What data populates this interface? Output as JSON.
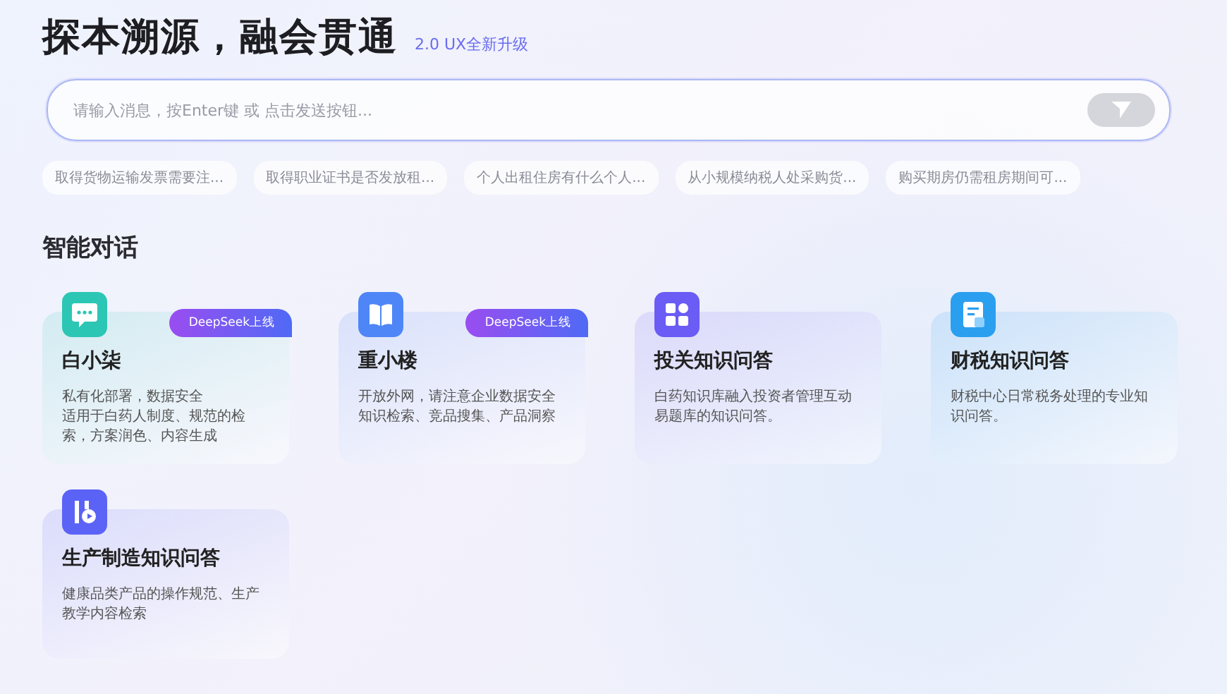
{
  "header": {
    "title": "探本溯源，融会贯通",
    "version_tag": "2.0 UX全新升级"
  },
  "chat_input": {
    "placeholder": "请输入消息，按Enter键 或 点击发送按钮..."
  },
  "suggestions": [
    "取得货物运输发票需要注...",
    "取得职业证书是否发放租...",
    "个人出租住房有什么个人...",
    "从小规模纳税人处采购货...",
    "购买期房仍需租房期间可..."
  ],
  "section_title": "智能对话",
  "assistants": [
    {
      "kind": "chat",
      "color": "#2cc6b4",
      "title": "白小柒",
      "badge": "DeepSeek上线",
      "description": [
        "私有化部署，数据安全",
        "适用于白药人制度、规范的检索，方案润色、内容生成"
      ]
    },
    {
      "kind": "book",
      "color": "#4f86f7",
      "title": "重小楼",
      "badge": "DeepSeek上线",
      "description": [
        "开放外网，请注意企业数据安全",
        "知识检索、竞品搜集、产品洞察"
      ]
    },
    {
      "kind": "grid",
      "color": "#6a5cf5",
      "title": "投关知识问答",
      "description": [
        "白药知识库融入投资者管理互动易题库的知识问答。"
      ]
    },
    {
      "kind": "document",
      "color": "#2a9ff0",
      "title": "财税知识问答",
      "description": [
        "财税中心日常税务处理的专业知识问答。"
      ]
    },
    {
      "kind": "factory",
      "color": "#5b63f6",
      "title": "生产制造知识问答",
      "description": [
        "健康品类产品的操作规范、生产教学内容检索"
      ]
    }
  ]
}
